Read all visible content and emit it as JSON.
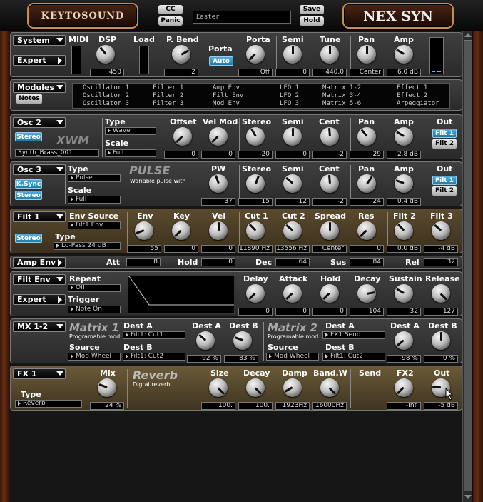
{
  "header": {
    "cc": "CC",
    "panic": "Panic",
    "preset": "Easter",
    "save": "Save",
    "hold": "Hold",
    "logo_left": "KEYTOSOUND",
    "logo_right": "NEX SYN"
  },
  "system": {
    "title": "System",
    "expert": "Expert",
    "midi": "MIDI",
    "dsp": "DSP",
    "dsp_val": "450",
    "load": "Load",
    "pbend": "P. Bend",
    "pbend_val": "2",
    "porta_title": "Porta",
    "auto": "Auto",
    "porta": "Porta",
    "porta_val": "Off",
    "semi": "Semi",
    "semi_val": "0",
    "tune": "Tune",
    "tune_val": "440.0",
    "pan": "Pan",
    "pan_val": "Center",
    "amp": "Amp",
    "amp_val": "6.0 dB"
  },
  "modules": {
    "title": "Modules",
    "notes": "Notes",
    "items": [
      [
        "Oscillator 1",
        "Filter 1",
        "Amp Env",
        "LFO 1",
        "Matrix 1-2",
        "Effect 1"
      ],
      [
        "Oscillator 2",
        "Filter 2",
        "Filt Env",
        "LFO 2",
        "Matrix 3-4",
        "Effect 2"
      ],
      [
        "Oscillator 3",
        "Filter 3",
        "Mod Env",
        "LFO 3",
        "Matrix 5-6",
        "Arpeggiator"
      ]
    ]
  },
  "osc2": {
    "title": "Osc 2",
    "stereo": "Stereo",
    "big": "XWM",
    "preset": "Synth_Brass_001",
    "type": "Type",
    "type_val": "Wave",
    "scale": "Scale",
    "scale_val": "Full",
    "offset": "Offset",
    "offset_val": "0",
    "velmod": "Vel Mod",
    "velmod_val": "0",
    "stereo_k": "Stereo",
    "stereo_val": "-20",
    "semi": "Semi",
    "semi_val": "0",
    "cent": "Cent",
    "cent_val": "-2",
    "pan": "Pan",
    "pan_val": "-29",
    "amp": "Amp",
    "amp_val": "2.8 dB",
    "out": "Out",
    "filt1": "Filt 1",
    "filt2": "Filt 2"
  },
  "osc3": {
    "title": "Osc 3",
    "ksync": "K.Sync",
    "stereo": "Stereo",
    "type": "Type",
    "type_val": "Pulse",
    "scale": "Scale",
    "scale_val": "Full",
    "big": "PULSE",
    "sub": "Wariable pulse with",
    "pw": "PW",
    "pw_val": "37",
    "stereo_k": "Stereo",
    "stereo_val": "15",
    "semi": "Semi",
    "semi_val": "-12",
    "cent": "Cent",
    "cent_val": "-2",
    "pan": "Pan",
    "pan_val": "24",
    "amp": "Amp",
    "amp_val": "0.4 dB",
    "out": "Out",
    "filt1": "Filt 1",
    "filt2": "Filt 2"
  },
  "filt1": {
    "title": "Filt 1",
    "stereo": "Stereo",
    "envsrc": "Env Source",
    "envsrc_val": "Filt1 Env",
    "type": "Type",
    "type_val": "Lo-Pass 24 dB",
    "env": "Env",
    "env_val": "55",
    "key": "Key",
    "key_val": "0",
    "vel": "Vel",
    "vel_val": "0",
    "cut1": "Cut 1",
    "cut1_val": "11890 Hz",
    "cut2": "Cut 2",
    "cut2_val": "13556 Hz",
    "spread": "Spread",
    "spread_val": "Center",
    "res": "Res",
    "res_val": "0",
    "f2": "Filt 2",
    "f2_val": "0.0 dB",
    "f3": "Filt 3",
    "f3_val": "-4 dB"
  },
  "ampenv": {
    "title": "Amp Env",
    "att": "Att",
    "att_val": "8",
    "hold": "Hold",
    "hold_val": "0",
    "dec": "Dec",
    "dec_val": "64",
    "sus": "Sus",
    "sus_val": "84",
    "rel": "Rel",
    "rel_val": "32"
  },
  "filtenv": {
    "title": "Filt Env",
    "expert": "Expert",
    "repeat": "Repeat",
    "repeat_val": "Off",
    "trigger": "Trigger",
    "trigger_val": "Note On",
    "delay": "Delay",
    "delay_val": "0",
    "attack": "Attack",
    "attack_val": "0",
    "hold": "Hold",
    "hold_val": "0",
    "decay": "Decay",
    "decay_val": "104",
    "sustain": "Sustain",
    "sustain_val": "32",
    "release": "Release",
    "release_val": "127"
  },
  "mx": {
    "title": "MX 1-2",
    "m1": "Matrix 1",
    "m1sub": "Programable mod.",
    "m2": "Matrix 2",
    "m2sub": "Programable mod.",
    "desta": "Dest A",
    "destb": "Dest B",
    "source": "Source",
    "m1_desta_val": "Filt1: Cut1",
    "m1_source_val": "Mod Wheel",
    "m1_destb_val": "Filt1: Cut2",
    "m1_ka": "92 %",
    "m1_kb": "83 %",
    "m2_desta_val": "FX1 Send",
    "m2_source_val": "Mod Wheel",
    "m2_destb_val": "Filt1: Cut2",
    "m2_ka": "-98 %",
    "m2_kb": "0 %"
  },
  "fx1": {
    "title": "FX 1",
    "type": "Type",
    "type_val": "Reverb",
    "mix": "Mix",
    "mix_val": "24 %",
    "big": "Reverb",
    "sub": "Digtal reverb",
    "size": "Size",
    "size_val": "100.",
    "decay": "Decay",
    "decay_val": "100.",
    "damp": "Damp",
    "damp_val": "1923Hz",
    "bandw": "Band.W",
    "bandw_val": "16000Hz",
    "send": "Send",
    "fx2": "FX2",
    "fx2_val": "-Inf.",
    "out": "Out",
    "out_val": "-5 dB"
  }
}
